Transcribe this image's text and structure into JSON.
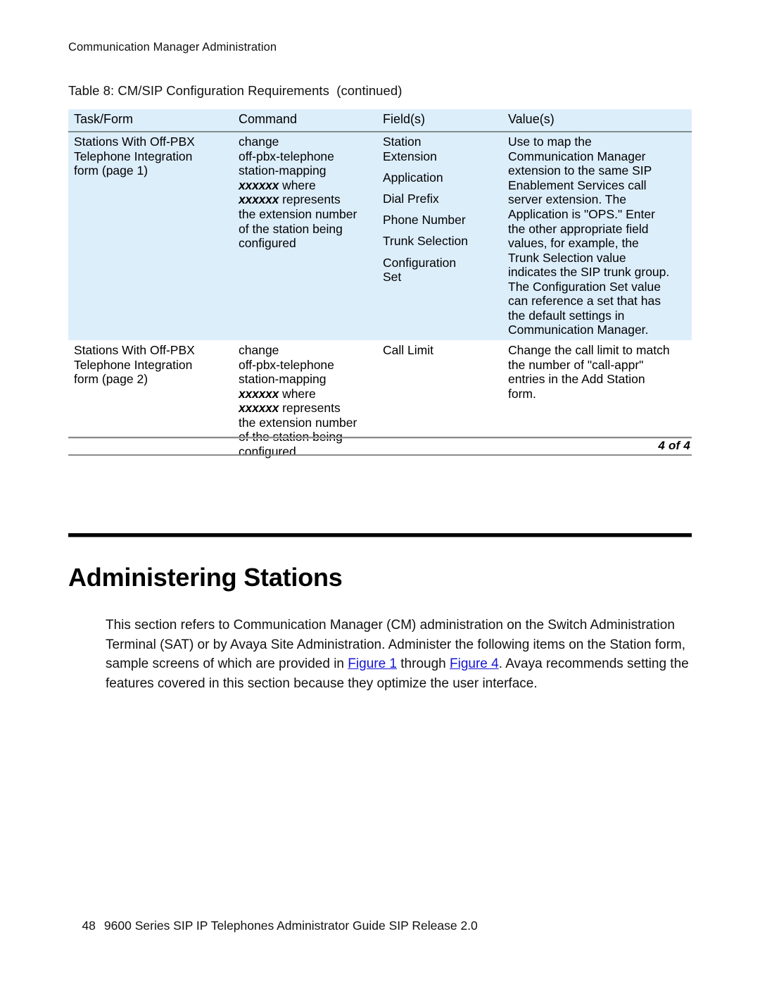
{
  "document": {
    "running_header": "Communication Manager Administration",
    "page_footer_number": "48",
    "page_footer_title": "9600 Series SIP IP Telephones Administrator Guide SIP Release 2.0"
  },
  "table": {
    "caption": "Table 8: CM/SIP Configuration Requirements  (continued)",
    "page_of": "4 of 4",
    "headers": [
      "Task/Form",
      "Command",
      "Field(s)",
      "Value(s)"
    ],
    "rows": [
      {
        "shaded": true,
        "task_form": [
          "Stations With Off-PBX",
          "Telephone Integration",
          "form (page 1)"
        ],
        "command_pre": [
          "change",
          "off-pbx-telephone",
          "station-mapping"
        ],
        "command_x1": "xxxxxx",
        "command_x1_rest": " where",
        "command_x2": "xxxxxx",
        "command_x2_rest": " represents",
        "command_post": [
          "the extension number",
          "of the station being",
          "configured"
        ],
        "fields": [
          "Station",
          "Extension",
          "",
          "Application",
          "",
          "Dial Prefix",
          "",
          "Phone Number",
          "",
          "Trunk Selection",
          "",
          "Configuration",
          "Set"
        ],
        "values": [
          "Use to map the",
          "Communication Manager",
          "extension to the same SIP",
          "Enablement Services call",
          "server extension. The",
          "Application is \"OPS.\" Enter",
          "the other appropriate field",
          "values, for example, the",
          "Trunk Selection value",
          "indicates the SIP trunk group.",
          "The Configuration Set value",
          "can reference a set that has",
          "the default settings in",
          "Communication Manager."
        ]
      },
      {
        "shaded": false,
        "task_form": [
          "Stations With Off-PBX",
          "Telephone Integration",
          "form (page 2)"
        ],
        "command_pre": [
          "change",
          "off-pbx-telephone",
          "station-mapping"
        ],
        "command_x1": "xxxxxx",
        "command_x1_rest": " where",
        "command_x2": "xxxxxx",
        "command_x2_rest": " represents",
        "command_post": [
          "the extension number",
          "of the station being",
          "configured"
        ],
        "fields": [
          "Call Limit"
        ],
        "values": [
          "Change the call limit to match",
          "the number of \"call-appr\"",
          "entries in the Add Station",
          "form."
        ]
      }
    ]
  },
  "section": {
    "title": "Administering Stations",
    "paragraph_part1": "This section refers to Communication Manager (CM) administration on the Switch Administration Terminal (SAT) or by Avaya Site Administration. Administer the following items on the Station form, sample screens of which are provided in ",
    "link1": "Figure 1",
    "paragraph_part2": " through ",
    "link2": "Figure 4",
    "paragraph_part3": ". Avaya recommends setting the features covered in this section because they optimize the user interface."
  },
  "colors": {
    "table_shade": "#ddeefb",
    "link": "#1414d2",
    "rule": "#8a8a8a",
    "header_divider": "#7f8f8c"
  }
}
